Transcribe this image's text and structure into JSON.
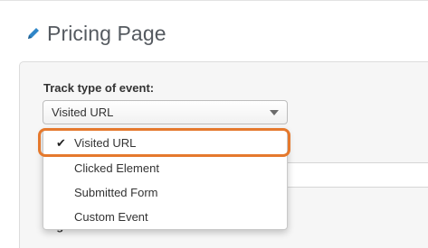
{
  "header": {
    "title": "Pricing Page",
    "icon": "pencil-icon",
    "icon_color": "#2f86c8"
  },
  "form": {
    "event_type_label": "Track type of event:",
    "event_type_selected": "Visited URL",
    "tags_label_partial": "Tags:"
  },
  "dropdown": {
    "options": [
      {
        "label": "Visited URL",
        "selected": true
      },
      {
        "label": "Clicked Element",
        "selected": false
      },
      {
        "label": "Submitted Form",
        "selected": false
      },
      {
        "label": "Custom Event",
        "selected": false
      }
    ],
    "checkmark": "✔"
  },
  "colors": {
    "highlight": "#e5792d",
    "panel_bg": "#f6f6f6"
  }
}
